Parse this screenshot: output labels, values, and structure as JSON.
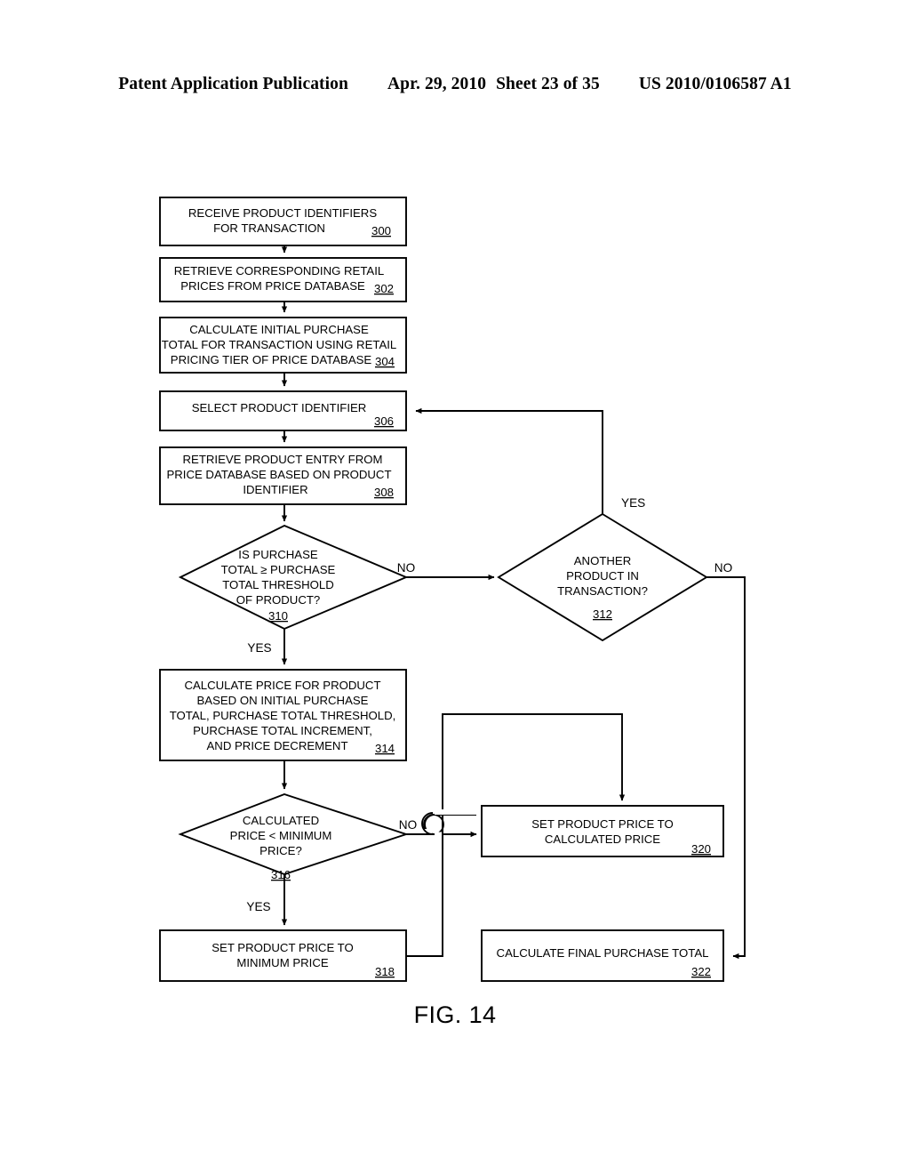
{
  "header": {
    "publication": "Patent Application Publication",
    "date": "Apr. 29, 2010",
    "sheet": "Sheet 23 of 35",
    "patent_number": "US 2010/0106587 A1"
  },
  "figure": {
    "caption": "FIG. 14",
    "type": "flowchart"
  },
  "flowchart": {
    "nodes": [
      {
        "id": "300",
        "shape": "process",
        "ref": "300",
        "lines": [
          "RECEIVE PRODUCT IDENTIFIERS",
          "FOR TRANSACTION"
        ]
      },
      {
        "id": "302",
        "shape": "process",
        "ref": "302",
        "lines": [
          "RETRIEVE CORRESPONDING RETAIL",
          "PRICES FROM PRICE DATABASE"
        ]
      },
      {
        "id": "304",
        "shape": "process",
        "ref": "304",
        "lines": [
          "CALCULATE INITIAL PURCHASE",
          "TOTAL FOR TRANSACTION USING RETAIL",
          "PRICING TIER OF PRICE DATABASE"
        ]
      },
      {
        "id": "306",
        "shape": "process",
        "ref": "306",
        "lines": [
          "SELECT PRODUCT IDENTIFIER"
        ]
      },
      {
        "id": "308",
        "shape": "process",
        "ref": "308",
        "lines": [
          "RETRIEVE PRODUCT ENTRY FROM",
          "PRICE DATABASE BASED ON PRODUCT",
          "IDENTIFIER"
        ]
      },
      {
        "id": "310",
        "shape": "decision",
        "ref": "310",
        "lines": [
          "IS PURCHASE",
          "TOTAL ≥ PURCHASE",
          "TOTAL THRESHOLD",
          "OF PRODUCT?"
        ]
      },
      {
        "id": "312",
        "shape": "decision",
        "ref": "312",
        "lines": [
          "ANOTHER",
          "PRODUCT IN",
          "TRANSACTION?"
        ]
      },
      {
        "id": "314",
        "shape": "process",
        "ref": "314",
        "lines": [
          "CALCULATE PRICE FOR PRODUCT",
          "BASED  ON INITIAL PURCHASE",
          "TOTAL, PURCHASE TOTAL THRESHOLD,",
          "PURCHASE TOTAL INCREMENT,",
          "AND PRICE DECREMENT"
        ]
      },
      {
        "id": "316",
        "shape": "decision",
        "ref": "316",
        "lines": [
          "CALCULATED",
          "PRICE < MINIMUM",
          "PRICE?"
        ]
      },
      {
        "id": "318",
        "shape": "process",
        "ref": "318",
        "lines": [
          "SET PRODUCT PRICE TO",
          "MINIMUM PRICE"
        ]
      },
      {
        "id": "320",
        "shape": "process",
        "ref": "320",
        "lines": [
          "SET PRODUCT PRICE TO",
          "CALCULATED PRICE"
        ]
      },
      {
        "id": "322",
        "shape": "process",
        "ref": "322",
        "lines": [
          "CALCULATE FINAL PURCHASE TOTAL"
        ]
      }
    ],
    "edge_labels": {
      "no_310_to_312": "NO",
      "yes_310_to_314": "YES",
      "yes_312_to_306": "YES",
      "no_312_to_322": "NO",
      "no_316_to_320": "NO",
      "yes_316_to_318": "YES"
    },
    "colors": {
      "stroke": "#000000",
      "background": "#ffffff",
      "text": "#000000"
    }
  }
}
